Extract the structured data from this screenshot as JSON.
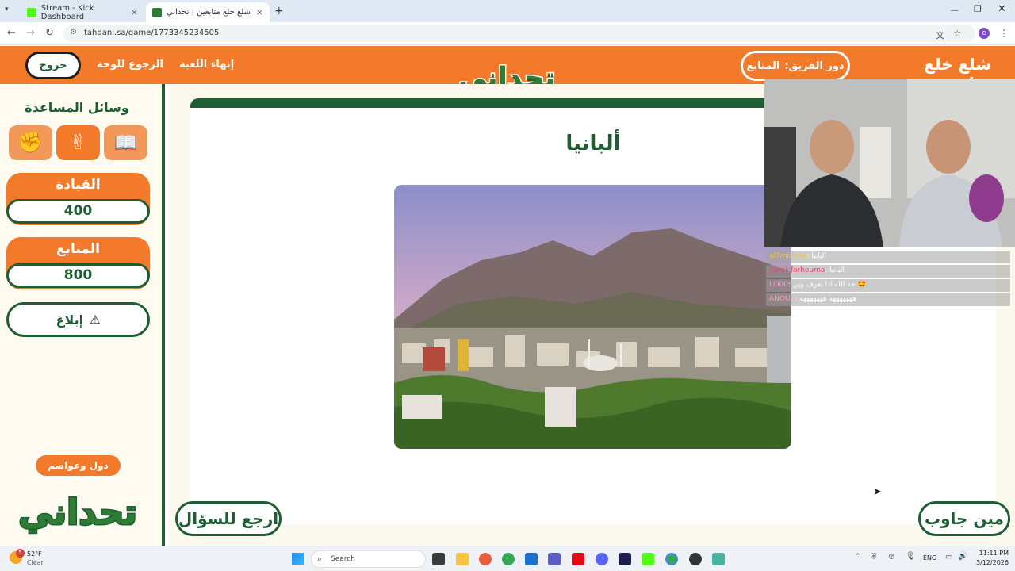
{
  "browser": {
    "tabs": [
      {
        "label": "Stream - Kick Dashboard",
        "active": false
      },
      {
        "label": "شلع خلع متابعين | تحداني",
        "active": true
      }
    ],
    "url": "tahdani.sa/game/1773345234505",
    "new_tab": "+",
    "close": "×"
  },
  "header": {
    "game_title": "شلع خلع متابعين",
    "team_turn_label": "دور الفريق:",
    "team_turn_value": "المتابع",
    "end_game": "إنهاء اللعبة",
    "back_to_board": "الرجوع للوحة",
    "exit": "خروج",
    "logo_text": "تحداني"
  },
  "sidebar": {
    "aids_title": "وسائل المساعدة",
    "aids": [
      "book-aid-icon",
      "peace-hand-icon",
      "fist-hand-icon"
    ],
    "teams": [
      {
        "name": "القيادة",
        "score": "400"
      },
      {
        "name": "المتابع",
        "score": "800"
      }
    ],
    "report": "إبلاغ",
    "category": "دول وعواصم",
    "logo_text": "تحداني"
  },
  "question": {
    "answer": "ألبانيا",
    "back_to_question": "ارجع للسؤال",
    "who_answered": "مين جاوب"
  },
  "chat": [
    {
      "user": "al7mblone",
      "message": "البانيا"
    },
    {
      "user": "Sami_farhouma",
      "message": "البانيا"
    },
    {
      "user": "Lili00",
      "message": "حد الله اذا يعرف وين 🤩"
    },
    {
      "user": "ANOU..",
      "message": "هههههههه هههههههه"
    }
  ],
  "taskbar": {
    "weather_temp": "52°F",
    "weather_desc": "Clear",
    "weather_badge": "5",
    "search_placeholder": "Search",
    "lang": "ENG",
    "time": "11:11 PM",
    "date": "3/12/2026"
  },
  "colors": {
    "orange": "#f27a2a",
    "green": "#1f5d33",
    "cream": "#fbf9ee"
  }
}
